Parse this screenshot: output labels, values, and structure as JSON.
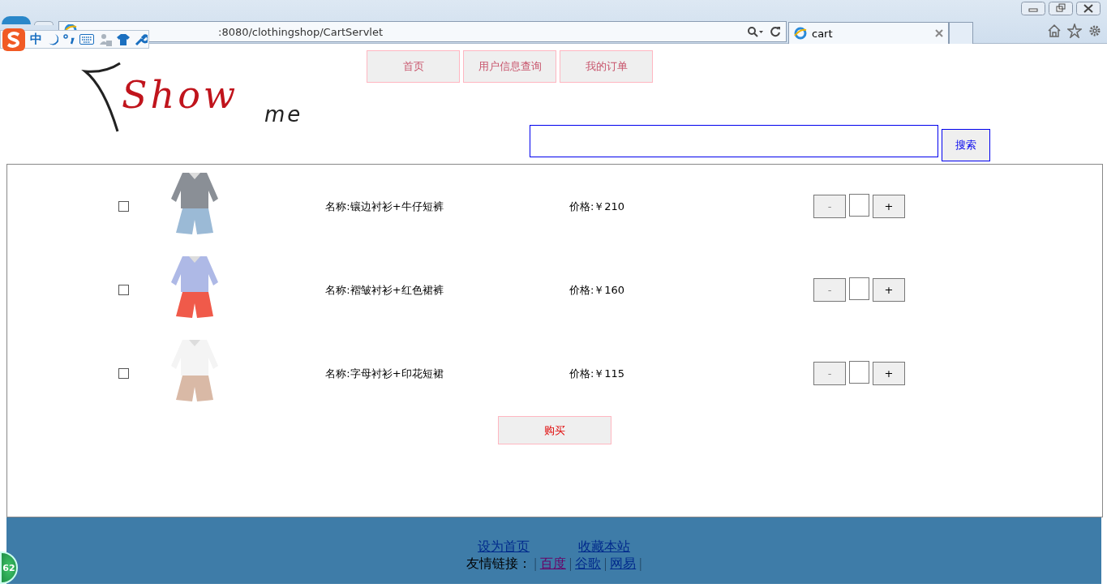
{
  "browser": {
    "address": ":8080/clothingshop/CartServlet",
    "tabs": [
      {
        "title": "cart",
        "selected": true
      }
    ]
  },
  "ime_toolbar": {
    "mode": "中"
  },
  "nav": [
    {
      "label": "首页"
    },
    {
      "label": "用户信息查询"
    },
    {
      "label": "我的订单"
    }
  ],
  "logo": {
    "first_word": "Show",
    "second_word": "me"
  },
  "search": {
    "button": "搜索"
  },
  "cart": {
    "items": [
      {
        "name": "名称:镶边衬衫+牛仔短裤",
        "price": "价格:￥210",
        "checked": false,
        "decrement": "-",
        "decrement_disabled": true,
        "increment": "+"
      },
      {
        "name": "名称:褶皱衬衫+红色裙裤",
        "price": "价格:￥160",
        "checked": false,
        "decrement": "-",
        "decrement_disabled": true,
        "increment": "+"
      },
      {
        "name": "名称:字母衬衫+印花短裙",
        "price": "价格:￥115",
        "checked": false,
        "decrement": "-",
        "decrement_disabled": true,
        "increment": "+"
      }
    ],
    "buy_button": "购买"
  },
  "footer": {
    "links": [
      "设为首页",
      "收藏本站"
    ],
    "friends_label": "友情链接：",
    "separator": "|",
    "friend_links": [
      {
        "label": "百度",
        "visited": true
      },
      {
        "label": "谷歌",
        "visited": false
      },
      {
        "label": "网易",
        "visited": false
      }
    ]
  },
  "badge": "62"
}
